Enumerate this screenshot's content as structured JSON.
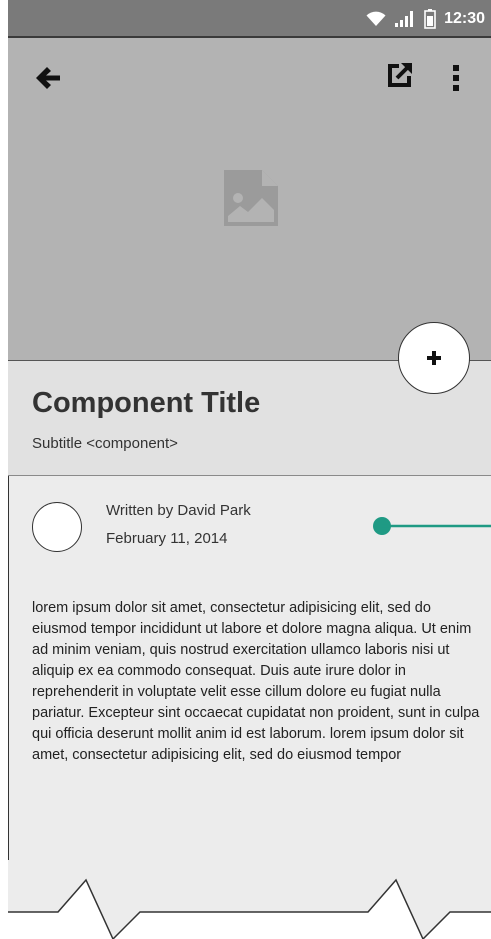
{
  "status_bar": {
    "time": "12:30",
    "icons": [
      "wifi-icon",
      "signal-icon",
      "battery-icon"
    ]
  },
  "app_bar": {
    "icons": [
      "back-arrow-icon",
      "share-icon",
      "more-vert-icon"
    ]
  },
  "header": {
    "image_icon": "image-placeholder-icon"
  },
  "component": {
    "title": "Component Title",
    "subtitle": "Subtitle <component>"
  },
  "fab": {
    "icon": "plus-icon",
    "label": "+"
  },
  "article": {
    "author": "Written by David Park",
    "date": "February 11, 2014",
    "body": "lorem ipsum dolor sit amet, consectetur adipisicing elit, sed do eiusmod tempor incididunt ut labore et dolore magna aliqua. Ut enim ad minim veniam, quis nostrud exercitation ullamco laboris nisi ut aliquip ex ea commodo consequat. Duis aute irure dolor in reprehenderit in voluptate velit esse cillum dolore eu fugiat nulla pariatur. Excepteur sint occaecat cupidatat non proident, sunt in culpa qui officia deserunt mollit anim id est laborum. lorem ipsum dolor sit amet, consectetur adipisicing elit, sed do eiusmod tempor"
  },
  "colors": {
    "status_bar": "#7a7a7a",
    "header_bg": "#b3b3b3",
    "title_panel_bg": "#e1e1e1",
    "content_bg": "#ececec",
    "annotation_accent": "#1f9a84"
  }
}
